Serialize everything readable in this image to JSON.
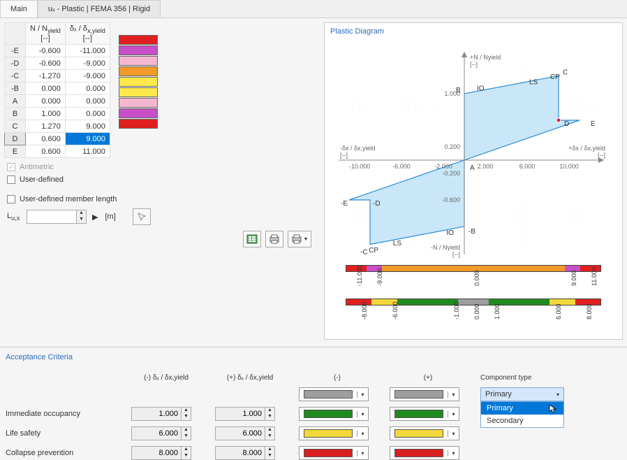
{
  "tabs": {
    "main": "Main",
    "active": "uₓ - Plastic | FEMA 356 | Rigid"
  },
  "table": {
    "col1_hdr_top": "N / N",
    "col1_hdr_sub": "yield",
    "col2_hdr_top": "δₓ / δ",
    "col2_hdr_sub": "x,yield",
    "unit": "[--]",
    "rows": [
      {
        "k": "-E",
        "v1": "-0.600",
        "v2": "-11.000",
        "color": "#e02020"
      },
      {
        "k": "-D",
        "v1": "-0.600",
        "v2": "-9.000",
        "color": "#c84fc8"
      },
      {
        "k": "-C",
        "v1": "-1.270",
        "v2": "-9.000",
        "color": "#f5b7d0"
      },
      {
        "k": "-B",
        "v1": "0.000",
        "v2": "0.000",
        "color": "#f39a2a"
      },
      {
        "k": "A",
        "v1": "0.000",
        "v2": "0.000",
        "color": "#ffe94a"
      },
      {
        "k": "B",
        "v1": "1.000",
        "v2": "0.000",
        "color": "#ffe94a"
      },
      {
        "k": "C",
        "v1": "1.270",
        "v2": "9.000",
        "color": "#f5b7d0"
      },
      {
        "k": "D",
        "v1": "0.600",
        "v2": "9.000",
        "color": "#c84fc8",
        "selected": true
      },
      {
        "k": "E",
        "v1": "0.600",
        "v2": "11.000",
        "color": "#e02020"
      }
    ]
  },
  "diagram_title": "Plastic Diagram",
  "chart_data": {
    "type": "line",
    "title": "Plastic Diagram",
    "xlabel": "+δₓ / δx,yield  [--]",
    "xlabel_neg": "-δₓ / δx,yield  [--]",
    "ylabel": "+N / Nyield  [--]",
    "ylabel_neg": "-N / Nyield  [--]",
    "xlim": [
      -11,
      11
    ],
    "ylim": [
      -1.4,
      1.4
    ],
    "x_ticks": [
      -10,
      -6,
      -2,
      2,
      6,
      10
    ],
    "y_ticks_pos": [
      0.2,
      1.0
    ],
    "y_ticks_neg": [
      -0.2,
      -0.6
    ],
    "points": [
      {
        "label": "-E",
        "x": -11.0,
        "y": -0.6
      },
      {
        "label": "-D",
        "x": -9.0,
        "y": -0.6
      },
      {
        "label": "-C",
        "x": -9.0,
        "y": -1.27
      },
      {
        "label": "-B",
        "x": 0.0,
        "y": -1.0
      },
      {
        "label": "A",
        "x": 0.0,
        "y": 0.0
      },
      {
        "label": "B",
        "x": 0.0,
        "y": 1.0
      },
      {
        "label": "C",
        "x": 9.0,
        "y": 1.27
      },
      {
        "label": "D",
        "x": 9.0,
        "y": 0.6
      },
      {
        "label": "E",
        "x": 11.0,
        "y": 0.6
      }
    ],
    "annotations": [
      "IO",
      "LS",
      "CP",
      "IO",
      "LS",
      "CP"
    ]
  },
  "bars": {
    "bar1_ticks": [
      "-11.000",
      "-9.000",
      "0.000",
      "9.000",
      "11.000"
    ],
    "bar2_ticks": [
      "-8.000",
      "-6.000",
      "-1.000",
      "0.000",
      "1.000",
      "6.000",
      "8.000"
    ]
  },
  "controls": {
    "antimetric": "Antimetric",
    "user_defined": "User-defined",
    "user_defined_member": "User-defined member length",
    "Lux": "L",
    "Lux_sub": "u,x",
    "unit_m": "[m]"
  },
  "acceptance": {
    "title": "Acceptance Criteria",
    "neg_hdr": "(-) δₓ / δx,yield",
    "pos_hdr": "(+) δₓ / δx,yield",
    "col_neg": "(-)",
    "col_pos": "(+)",
    "component_type_label": "Component type",
    "rows": [
      {
        "label": "Immediate occupancy",
        "neg": "1.000",
        "pos": "1.000"
      },
      {
        "label": "Life safety",
        "neg": "6.000",
        "pos": "6.000"
      },
      {
        "label": "Collapse prevention",
        "neg": "8.000",
        "pos": "8.000"
      }
    ],
    "colors": {
      "grey": "#9e9e9e",
      "green": "#1f8a1f",
      "yellow": "#f2d83a",
      "red": "#d82020"
    },
    "component_type": {
      "selected": "Primary",
      "options": [
        "Primary",
        "Secondary"
      ]
    }
  }
}
